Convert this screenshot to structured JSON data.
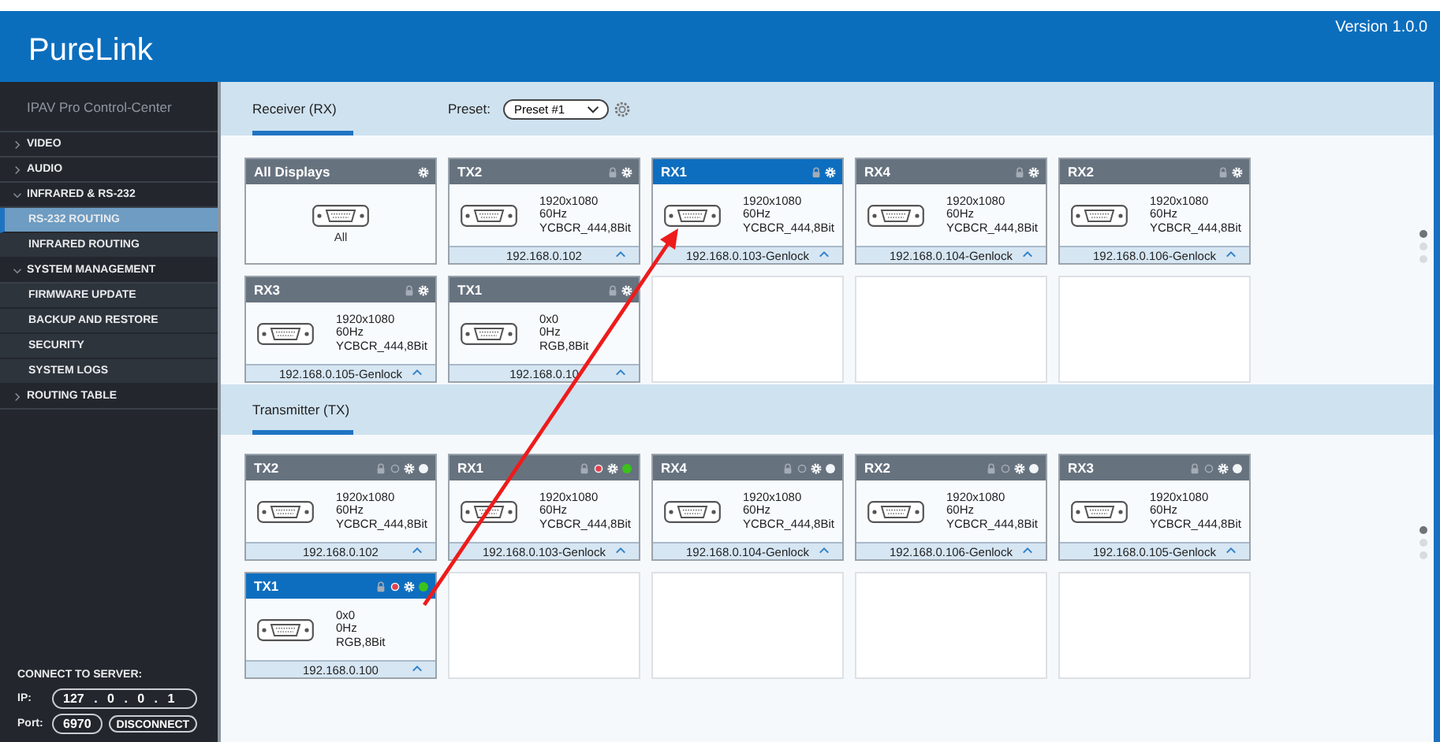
{
  "app": {
    "logo": "PureLink",
    "version": "Version 1.0.0"
  },
  "sidebar": {
    "title": "IPAV Pro Control-Center",
    "items": [
      {
        "label": "VIDEO",
        "expanded": false
      },
      {
        "label": "AUDIO",
        "expanded": false
      },
      {
        "label": "INFRARED & RS-232",
        "expanded": true,
        "children": [
          {
            "label": "RS-232 ROUTING",
            "selected": true
          },
          {
            "label": "INFRARED ROUTING",
            "selected": false
          }
        ]
      },
      {
        "label": "SYSTEM MANAGEMENT",
        "expanded": true,
        "children": [
          {
            "label": "FIRMWARE UPDATE",
            "selected": false
          },
          {
            "label": "BACKUP AND RESTORE",
            "selected": false
          },
          {
            "label": "SECURITY",
            "selected": false
          },
          {
            "label": "SYSTEM LOGS",
            "selected": false
          }
        ]
      },
      {
        "label": "ROUTING TABLE",
        "expanded": false
      }
    ],
    "connect": {
      "title": "CONNECT TO SERVER:",
      "ip_label": "IP:",
      "ip": "127 . 0 . 0 . 1",
      "port_label": "Port:",
      "port": "6970",
      "button": "DISCONNECT"
    }
  },
  "receivers": {
    "tab": "Receiver (RX)",
    "preset_label": "Preset:",
    "preset": "Preset #1",
    "cards": [
      {
        "kind": "all",
        "title": "All Displays",
        "label": "All",
        "selected": false
      },
      {
        "kind": "rx",
        "title": "TX2",
        "lines": [
          "1920x1080",
          "60Hz",
          "YCBCR_444,8Bit"
        ],
        "address": "192.168.0.102",
        "selected": false
      },
      {
        "kind": "rx",
        "title": "RX1",
        "lines": [
          "1920x1080",
          "60Hz",
          "YCBCR_444,8Bit"
        ],
        "address": "192.168.0.103-Genlock",
        "selected": true
      },
      {
        "kind": "rx",
        "title": "RX4",
        "lines": [
          "1920x1080",
          "60Hz",
          "YCBCR_444,8Bit"
        ],
        "address": "192.168.0.104-Genlock",
        "selected": false
      },
      {
        "kind": "rx",
        "title": "RX2",
        "lines": [
          "1920x1080",
          "60Hz",
          "YCBCR_444,8Bit"
        ],
        "address": "192.168.0.106-Genlock",
        "selected": false
      },
      {
        "kind": "rx",
        "title": "RX3",
        "lines": [
          "1920x1080",
          "60Hz",
          "YCBCR_444,8Bit"
        ],
        "address": "192.168.0.105-Genlock",
        "selected": false
      },
      {
        "kind": "rx",
        "title": "TX1",
        "lines": [
          "0x0",
          "0Hz",
          "RGB,8Bit"
        ],
        "address": "192.168.0.10",
        "selected": false
      }
    ],
    "pager": [
      {
        "selected": true
      },
      {
        "selected": false
      },
      {
        "selected": false
      }
    ]
  },
  "transmitters": {
    "tab": "Transmitter (TX)",
    "cards": [
      {
        "kind": "tx",
        "title": "TX2",
        "lines": [
          "1920x1080",
          "60Hz",
          "YCBCR_444,8Bit"
        ],
        "address": "192.168.0.102",
        "selected": false,
        "alert": false,
        "linked": false
      },
      {
        "kind": "tx",
        "title": "RX1",
        "lines": [
          "1920x1080",
          "60Hz",
          "YCBCR_444,8Bit"
        ],
        "address": "192.168.0.103-Genlock",
        "selected": false,
        "alert": true,
        "linked": true
      },
      {
        "kind": "tx",
        "title": "RX4",
        "lines": [
          "1920x1080",
          "60Hz",
          "YCBCR_444,8Bit"
        ],
        "address": "192.168.0.104-Genlock",
        "selected": false,
        "alert": false,
        "linked": false
      },
      {
        "kind": "tx",
        "title": "RX2",
        "lines": [
          "1920x1080",
          "60Hz",
          "YCBCR_444,8Bit"
        ],
        "address": "192.168.0.106-Genlock",
        "selected": false,
        "alert": false,
        "linked": false
      },
      {
        "kind": "tx",
        "title": "RX3",
        "lines": [
          "1920x1080",
          "60Hz",
          "YCBCR_444,8Bit"
        ],
        "address": "192.168.0.105-Genlock",
        "selected": false,
        "alert": false,
        "linked": false
      },
      {
        "kind": "tx",
        "title": "TX1",
        "lines": [
          "0x0",
          "0Hz",
          "RGB,8Bit"
        ],
        "address": "192.168.0.100",
        "selected": true,
        "alert": true,
        "linked": true
      }
    ],
    "pager": [
      {
        "selected": true
      },
      {
        "selected": false
      },
      {
        "selected": false
      }
    ]
  }
}
